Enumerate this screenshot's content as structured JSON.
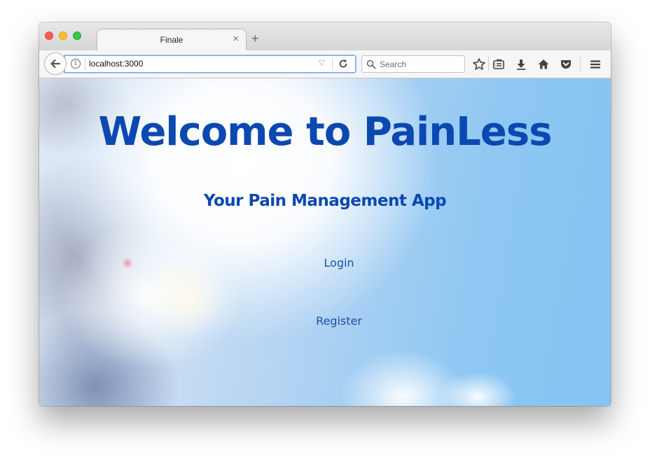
{
  "browser": {
    "tab_title": "Finale",
    "tab_close": "×",
    "new_tab": "+",
    "url": "localhost:3000",
    "search_placeholder": "Search"
  },
  "page": {
    "title": "Welcome to PainLess",
    "subtitle": "Your Pain Management App",
    "login_label": "Login",
    "register_label": "Register"
  },
  "colors": {
    "heading": "#0b48b0",
    "link": "#1d4fa8",
    "sky": "#86c4f2"
  },
  "icons": [
    "back-arrow-icon",
    "info-icon",
    "url-dropdown-icon",
    "reload-icon",
    "search-icon",
    "bookmark-star-icon",
    "reading-list-icon",
    "download-icon",
    "home-icon",
    "pocket-icon",
    "hamburger-menu-icon"
  ]
}
